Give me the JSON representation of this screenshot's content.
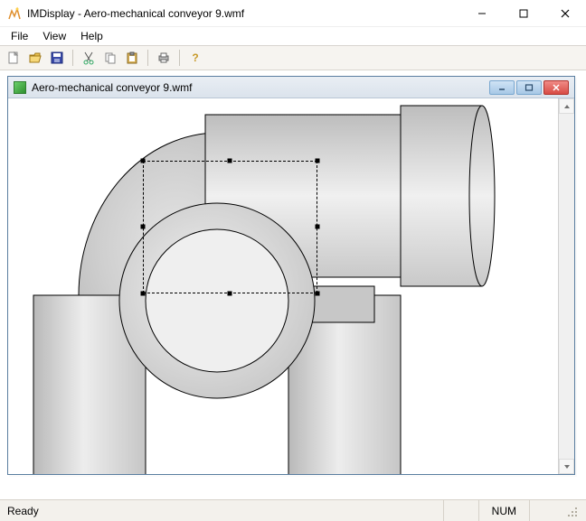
{
  "window": {
    "title": "IMDisplay - Aero-mechanical conveyor 9.wmf"
  },
  "menu": {
    "file": "File",
    "view": "View",
    "help": "Help"
  },
  "toolbar": {
    "new": "new-file-icon",
    "open": "open-folder-icon",
    "save": "save-icon",
    "cut": "cut-icon",
    "copy": "copy-icon",
    "paste": "paste-icon",
    "print": "print-icon",
    "help": "help-icon"
  },
  "mdi": {
    "title": "Aero-mechanical conveyor 9.wmf"
  },
  "status": {
    "ready": "Ready",
    "num": "NUM"
  },
  "colors": {
    "frame_blue": "#5a7ea0",
    "mdi_grad_top": "#e9eef4",
    "mdi_grad_bot": "#dbe3ec",
    "toolbar_bg": "#f6f4f0"
  }
}
